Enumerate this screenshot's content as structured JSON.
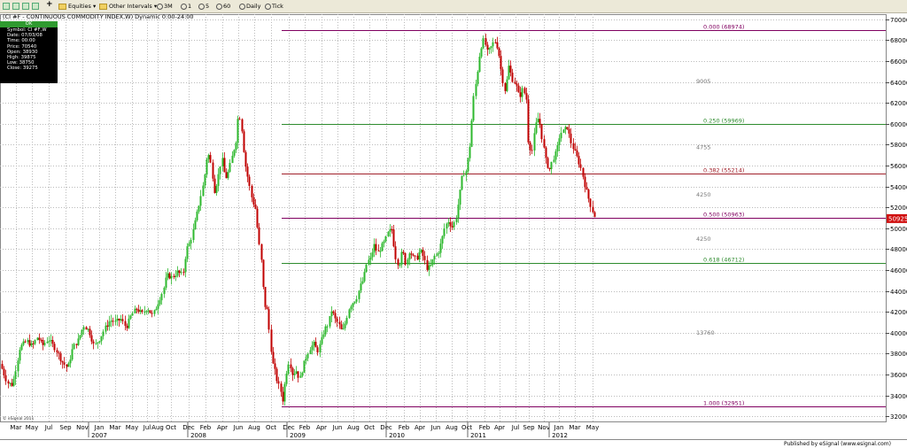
{
  "toolbar": {
    "equities": "Equities",
    "other_intervals": "Other Intervals",
    "interval_3m": "3M",
    "interval_1": "1",
    "interval_5": "5",
    "interval_60": "60",
    "daily": "Daily",
    "tick": "Tick"
  },
  "chart_title": "(CI #F - CONTINUOUS COMMODITY INDEX,W) Dynamic 0:00-24:00",
  "price_panel": {
    "header": "OK",
    "rows": [
      "Symbol: CI #F,W",
      "Date: 07/03/08",
      "Time: 00:00",
      "Price: 70540",
      "Open: 38930",
      "High: 39875",
      "Low: 38750",
      "Close: 39275"
    ]
  },
  "copyright": "© eSignal 2011",
  "publisher": "Published by eSignal (www.esignal.com)",
  "current_price": "50925",
  "colors": {
    "up": "#2eb82e",
    "down": "#c00000",
    "fib_green": "#2e8b2e",
    "fib_red": "#a0202a",
    "fib_purple": "#800060",
    "price_tag": "#d01010"
  },
  "chart_data": {
    "type": "candlestick",
    "y_range": [
      31500,
      70500
    ],
    "y_ticks": [
      32000,
      34000,
      36000,
      38000,
      40000,
      42000,
      44000,
      46000,
      48000,
      50000,
      52000,
      54000,
      56000,
      58000,
      60000,
      62000,
      64000,
      66000,
      68000,
      70000
    ],
    "x_months": [
      "Mar",
      "May",
      "Jul",
      "Sep",
      "Nov",
      "Jan",
      "Mar",
      "May",
      "Jul",
      "Aug",
      "Oct",
      "Dec",
      "Feb",
      "Apr",
      "Jun",
      "Aug",
      "Oct",
      "Dec",
      "Feb",
      "Apr",
      "Jun",
      "Aug",
      "Oct",
      "Dec",
      "Feb",
      "Apr",
      "Jun",
      "Aug",
      "Oct",
      "Feb",
      "Apr",
      "Jul",
      "Sep",
      "Nov",
      "Jan",
      "Mar",
      "May"
    ],
    "x_years": [
      "2007",
      "2008",
      "2009",
      "2010",
      "2011",
      "2012"
    ],
    "fib_levels": [
      {
        "label": "0.000 (68974)",
        "value": 68974,
        "color": "fib_purple"
      },
      {
        "label": "0.250 (59969)",
        "value": 59969,
        "color": "fib_green"
      },
      {
        "label": "0.382 (55214)",
        "value": 55214,
        "color": "fib_red"
      },
      {
        "label": "0.500 (50963)",
        "value": 50963,
        "color": "fib_purple"
      },
      {
        "label": "0.618 (46712)",
        "value": 46712,
        "color": "fib_green"
      },
      {
        "label": "1.000 (32951)",
        "value": 32951,
        "color": "fib_purple"
      }
    ],
    "diff_labels": [
      {
        "text": "9005",
        "value": 63900
      },
      {
        "text": "4755",
        "value": 57550
      },
      {
        "text": "4250",
        "value": 53050
      },
      {
        "text": "4250",
        "value": 48800
      },
      {
        "text": "13760",
        "value": 39800
      }
    ],
    "price_path": [
      [
        0,
        37000
      ],
      [
        8,
        35200
      ],
      [
        14,
        35000
      ],
      [
        22,
        38600
      ],
      [
        30,
        39200
      ],
      [
        36,
        38700
      ],
      [
        42,
        39600
      ],
      [
        48,
        38800
      ],
      [
        54,
        39400
      ],
      [
        62,
        38500
      ],
      [
        70,
        37200
      ],
      [
        76,
        36600
      ],
      [
        82,
        38600
      ],
      [
        88,
        39300
      ],
      [
        94,
        40700
      ],
      [
        100,
        40200
      ],
      [
        106,
        38700
      ],
      [
        112,
        39400
      ],
      [
        118,
        40400
      ],
      [
        124,
        41200
      ],
      [
        130,
        41000
      ],
      [
        136,
        41300
      ],
      [
        142,
        40500
      ],
      [
        148,
        41700
      ],
      [
        154,
        42300
      ],
      [
        160,
        41800
      ],
      [
        166,
        42400
      ],
      [
        172,
        41600
      ],
      [
        178,
        42900
      ],
      [
        184,
        44100
      ],
      [
        188,
        45500
      ],
      [
        194,
        45300
      ],
      [
        200,
        45800
      ],
      [
        206,
        45500
      ],
      [
        210,
        48000
      ],
      [
        214,
        48600
      ],
      [
        218,
        49900
      ],
      [
        222,
        51400
      ],
      [
        226,
        53000
      ],
      [
        230,
        54600
      ],
      [
        234,
        57400
      ],
      [
        238,
        56000
      ],
      [
        242,
        53500
      ],
      [
        246,
        55000
      ],
      [
        250,
        56800
      ],
      [
        254,
        54700
      ],
      [
        258,
        55500
      ],
      [
        262,
        57000
      ],
      [
        266,
        58400
      ],
      [
        269,
        61200
      ],
      [
        272,
        60000
      ],
      [
        276,
        56400
      ],
      [
        280,
        54600
      ],
      [
        284,
        52800
      ],
      [
        288,
        51900
      ],
      [
        292,
        48600
      ],
      [
        295,
        46600
      ],
      [
        298,
        42700
      ],
      [
        301,
        42300
      ],
      [
        304,
        39800
      ],
      [
        307,
        37200
      ],
      [
        310,
        36300
      ],
      [
        313,
        35200
      ],
      [
        316,
        34600
      ],
      [
        319,
        33500
      ],
      [
        322,
        35800
      ],
      [
        326,
        37400
      ],
      [
        330,
        36000
      ],
      [
        334,
        36400
      ],
      [
        338,
        35500
      ],
      [
        342,
        36800
      ],
      [
        346,
        37900
      ],
      [
        350,
        38600
      ],
      [
        354,
        38900
      ],
      [
        358,
        38200
      ],
      [
        362,
        39100
      ],
      [
        366,
        40300
      ],
      [
        370,
        40800
      ],
      [
        374,
        42200
      ],
      [
        378,
        41300
      ],
      [
        382,
        40800
      ],
      [
        386,
        40000
      ],
      [
        390,
        41100
      ],
      [
        394,
        42500
      ],
      [
        398,
        42900
      ],
      [
        402,
        43300
      ],
      [
        406,
        44400
      ],
      [
        410,
        45100
      ],
      [
        414,
        46800
      ],
      [
        418,
        47100
      ],
      [
        422,
        48400
      ],
      [
        426,
        47600
      ],
      [
        430,
        48200
      ],
      [
        434,
        48700
      ],
      [
        438,
        49600
      ],
      [
        442,
        49900
      ],
      [
        446,
        47300
      ],
      [
        450,
        46400
      ],
      [
        454,
        47900
      ],
      [
        458,
        46500
      ],
      [
        462,
        47900
      ],
      [
        466,
        47200
      ],
      [
        470,
        47100
      ],
      [
        474,
        47900
      ],
      [
        478,
        47200
      ],
      [
        482,
        46100
      ],
      [
        486,
        46400
      ],
      [
        490,
        47300
      ],
      [
        494,
        47600
      ],
      [
        498,
        48700
      ],
      [
        502,
        50200
      ],
      [
        506,
        50700
      ],
      [
        510,
        50100
      ],
      [
        514,
        50800
      ],
      [
        518,
        52900
      ],
      [
        522,
        55200
      ],
      [
        526,
        55500
      ],
      [
        530,
        57900
      ],
      [
        534,
        62300
      ],
      [
        538,
        64600
      ],
      [
        542,
        67200
      ],
      [
        546,
        68100
      ],
      [
        550,
        66800
      ],
      [
        554,
        67300
      ],
      [
        558,
        68000
      ],
      [
        562,
        67200
      ],
      [
        566,
        64700
      ],
      [
        570,
        63100
      ],
      [
        574,
        65500
      ],
      [
        578,
        64300
      ],
      [
        582,
        63800
      ],
      [
        586,
        62500
      ],
      [
        590,
        63400
      ],
      [
        594,
        62300
      ],
      [
        596,
        58400
      ],
      [
        600,
        57200
      ],
      [
        604,
        59800
      ],
      [
        608,
        60700
      ],
      [
        612,
        58400
      ],
      [
        616,
        56400
      ],
      [
        620,
        55600
      ],
      [
        624,
        56700
      ],
      [
        628,
        57300
      ],
      [
        632,
        59100
      ],
      [
        636,
        59300
      ],
      [
        640,
        59700
      ],
      [
        644,
        58300
      ],
      [
        648,
        57400
      ],
      [
        652,
        56600
      ],
      [
        656,
        55600
      ],
      [
        660,
        54100
      ],
      [
        664,
        52900
      ],
      [
        668,
        51800
      ],
      [
        672,
        50900
      ]
    ]
  }
}
